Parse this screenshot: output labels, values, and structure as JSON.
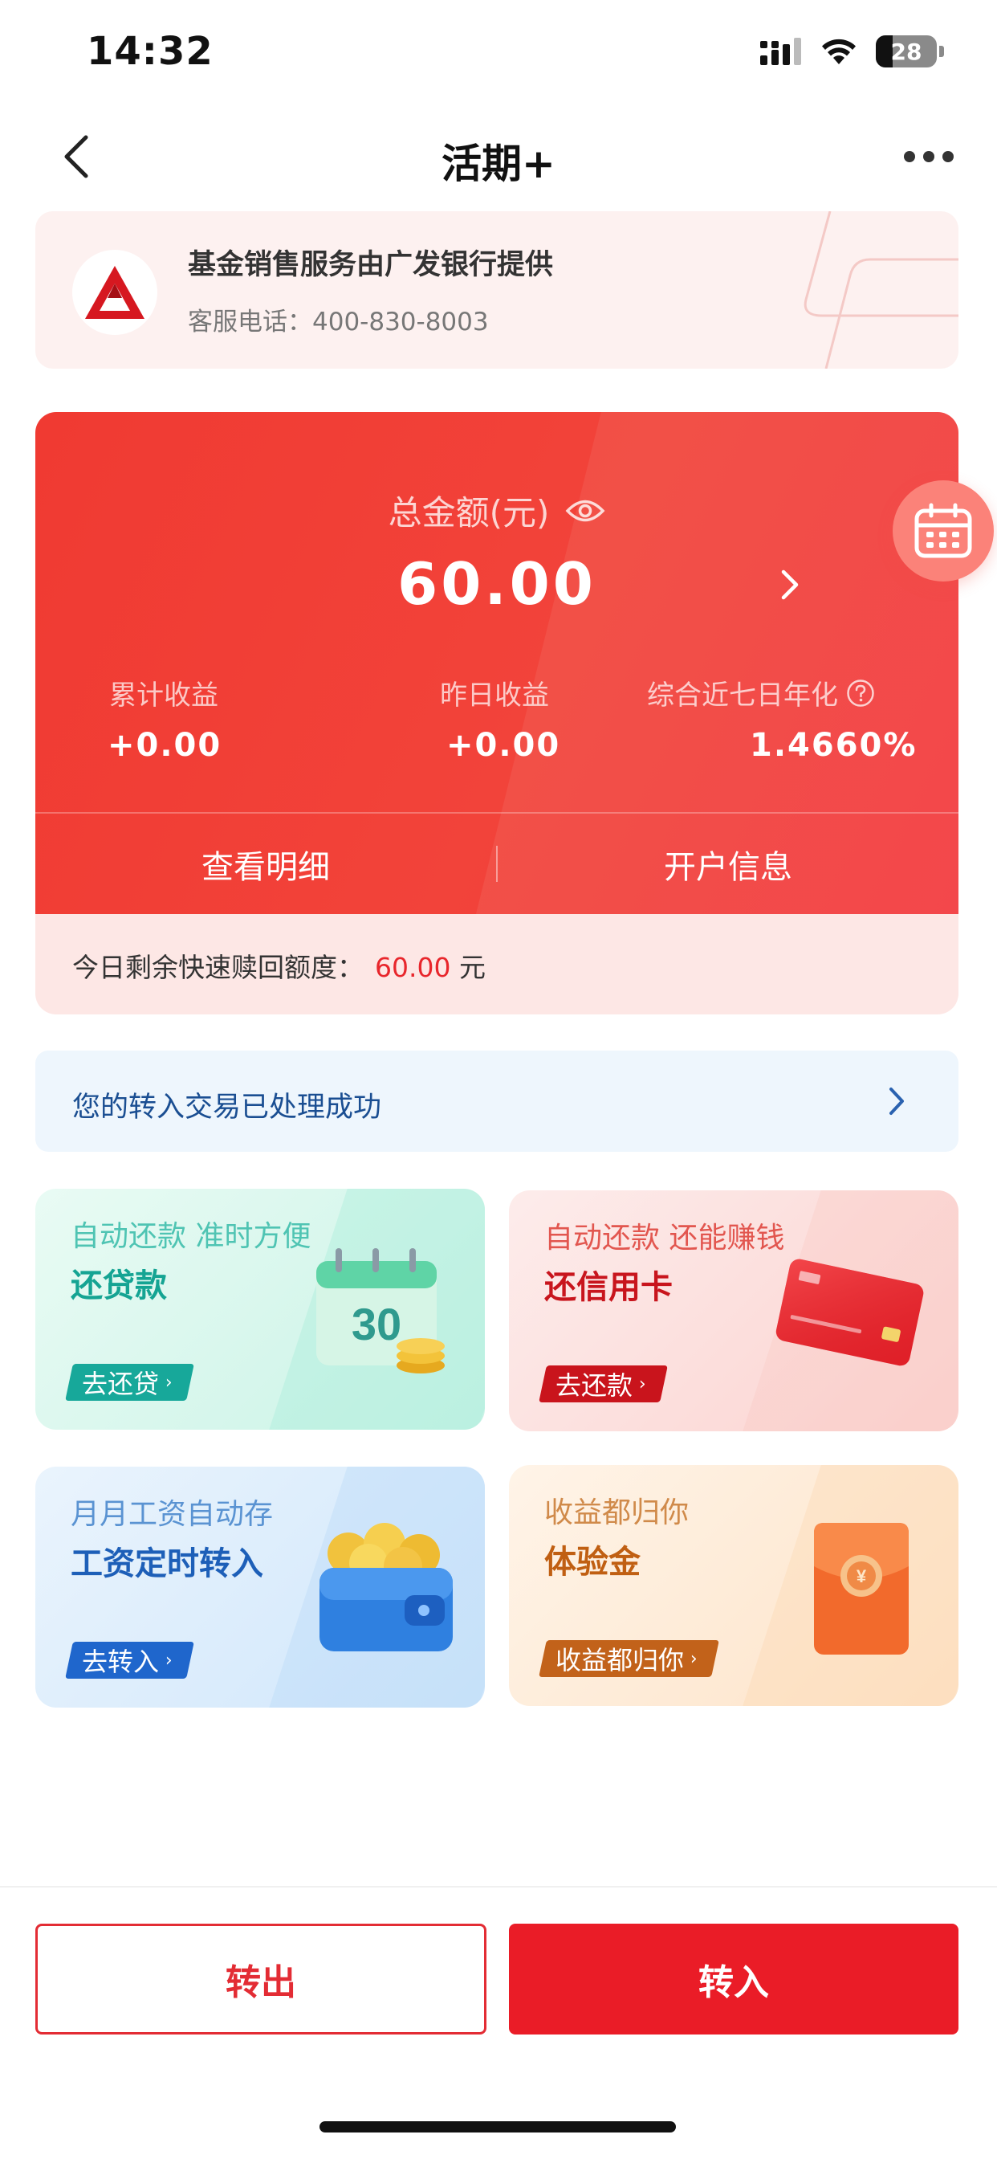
{
  "status_bar": {
    "time": "14:32",
    "battery": "28",
    "battery_level": 0.28
  },
  "nav": {
    "title": "活期+"
  },
  "provider": {
    "title": "基金销售服务由广发银行提供",
    "phone": "客服电话：400-830-8003"
  },
  "asset": {
    "total_label": "总金额(元)",
    "total_value": "60.00",
    "stats": [
      {
        "label": "累计收益",
        "value": "+0.00"
      },
      {
        "label": "昨日收益",
        "value": "+0.00"
      },
      {
        "label": "综合近七日年化",
        "value": "1.4660%"
      }
    ],
    "detail_button": "查看明细",
    "account_button": "开户信息",
    "quota_label": "今日剩余快速赎回额度：",
    "quota_value": "60.00",
    "quota_unit": "元"
  },
  "notice": {
    "text": "您的转入交易已处理成功"
  },
  "promos": [
    {
      "subtitle": "自动还款 准时方便",
      "title": "还贷款",
      "button": "去还贷",
      "art_text": "30",
      "color": "#17a89a"
    },
    {
      "subtitle": "自动还款 还能赚钱",
      "title": "还信用卡",
      "button": "去还款",
      "color": "#cc1c24"
    },
    {
      "subtitle": "月月工资自动存",
      "title": "工资定时转入",
      "button": "去转入",
      "color": "#1d63c8"
    },
    {
      "subtitle": "收益都归你",
      "title": "体验金",
      "button": "收益都归你",
      "color": "#c2621a"
    }
  ],
  "actions": {
    "out": "转出",
    "in": "转入"
  },
  "colors": {
    "brand_red": "#ea1c27",
    "card_red": "#f03a32",
    "link_blue": "#1a4e92"
  }
}
